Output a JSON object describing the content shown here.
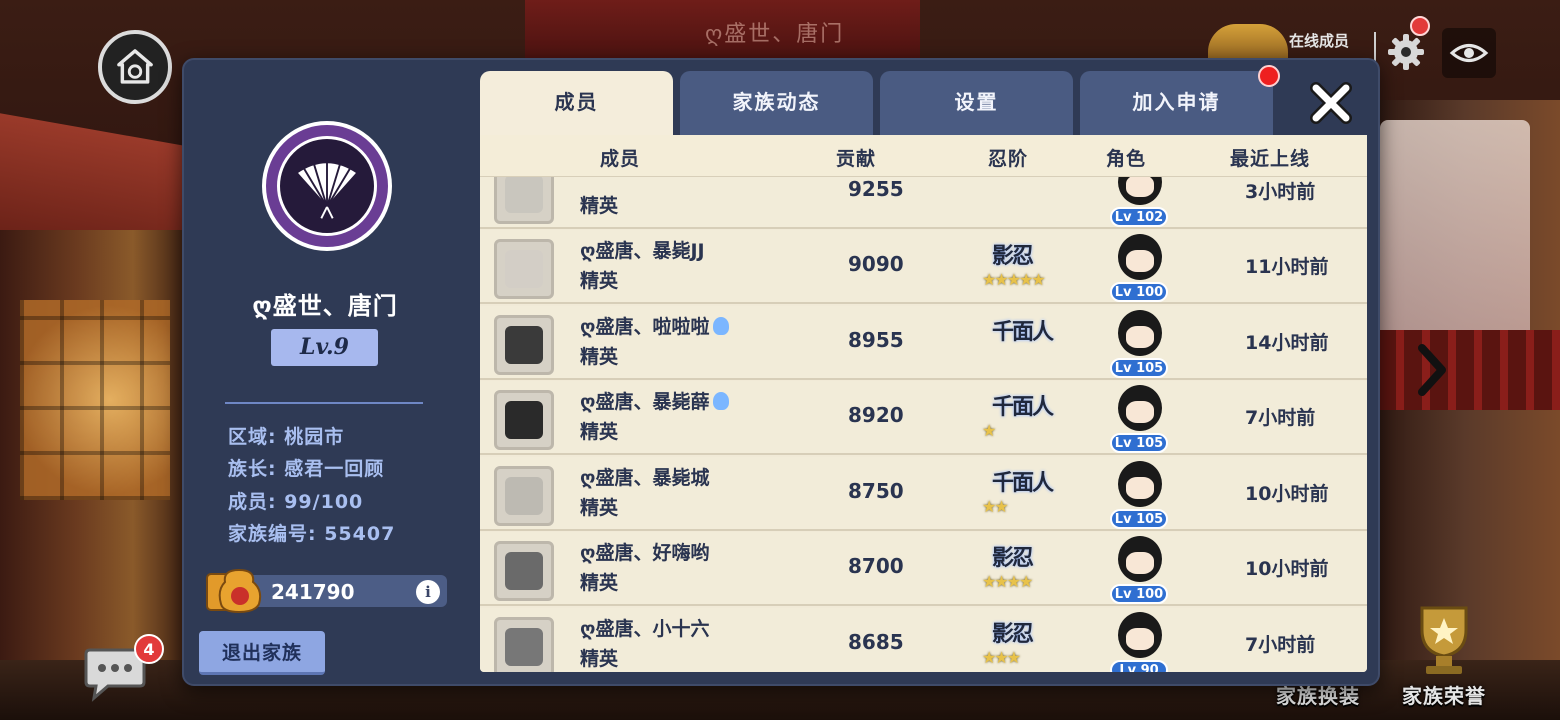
{
  "top_bar": {
    "clan_title": "ღ盛世、唐门",
    "clan_sub": "",
    "online_label": "在线成员"
  },
  "bottom": {
    "chat_badge": "4",
    "exchange_label": "家族换装",
    "honor_label": "家族荣誉"
  },
  "clan": {
    "name": "ღ盛世、唐门",
    "level": "Lv.9",
    "region": "区域: 桃园市",
    "leader": "族长: 感君一回顾",
    "members": "成员: 99/100",
    "id": "家族编号: 55407",
    "funds": "241790",
    "leave_button": "退出家族"
  },
  "tabs": [
    {
      "label": "成员",
      "active": true
    },
    {
      "label": "家族动态",
      "active": false
    },
    {
      "label": "设置",
      "active": false
    },
    {
      "label": "加入申请",
      "active": false
    }
  ],
  "table": {
    "headers": [
      "成员",
      "贡献",
      "忍阶",
      "角色",
      "最近上线"
    ],
    "rows": [
      {
        "name": "",
        "rank": "精英",
        "contrib": "9255",
        "ninja": "",
        "stars": "",
        "lv": "Lv 102",
        "last": "3小时前",
        "avatar_color": "#c9c6be"
      },
      {
        "name": "ღ盛唐、暴毙JJ",
        "rank": "精英",
        "contrib": "9090",
        "ninja": "影忍",
        "stars": "★★★★★",
        "lv": "Lv 100",
        "last": "11小时前",
        "avatar_color": "#d3cec6"
      },
      {
        "name": "ღ盛唐、啦啦啦",
        "rank": "精英",
        "contrib": "8955",
        "ninja": "千面人",
        "stars": "",
        "lv": "Lv 105",
        "last": "14小时前",
        "avatar_color": "#3a3a3a"
      },
      {
        "name": "ღ盛唐、暴毙薛",
        "rank": "精英",
        "contrib": "8920",
        "ninja": "千面人",
        "stars": "★",
        "lv": "Lv 105",
        "last": "7小时前",
        "avatar_color": "#2a2a2a"
      },
      {
        "name": "ღ盛唐、暴毙城",
        "rank": "精英",
        "contrib": "8750",
        "ninja": "千面人",
        "stars": "★★",
        "lv": "Lv 105",
        "last": "10小时前",
        "avatar_color": "#bdbab2"
      },
      {
        "name": "ღ盛唐、好嗨哟",
        "rank": "精英",
        "contrib": "8700",
        "ninja": "影忍",
        "stars": "★★★★",
        "lv": "Lv 100",
        "last": "10小时前",
        "avatar_color": "#6a6a6a"
      },
      {
        "name": "ღ盛唐、小十六",
        "rank": "精英",
        "contrib": "8685",
        "ninja": "影忍",
        "stars": "★★★",
        "lv": "Lv 90",
        "last": "7小时前",
        "avatar_color": "#777777"
      }
    ]
  },
  "colors": {
    "panel": "#2f3a55",
    "tab_active": "#f4eddb",
    "tab_inactive": "#4a5b82",
    "level_badge": "#2f6fd1",
    "notification": "#ee1f1f"
  }
}
